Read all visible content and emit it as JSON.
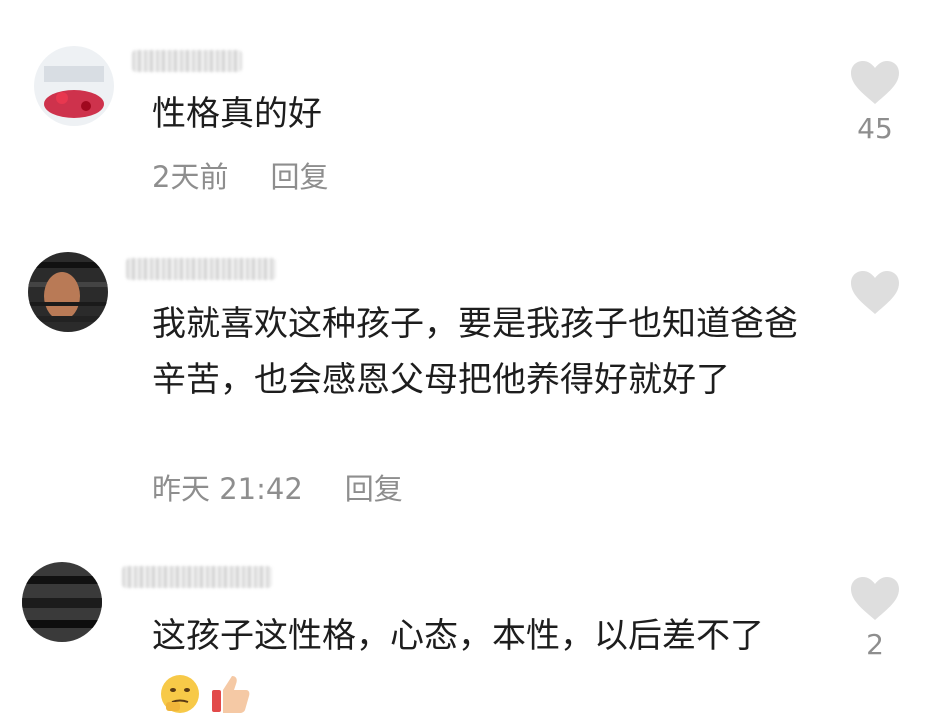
{
  "comments": [
    {
      "text": "性格真的好",
      "time": "2天前",
      "reply_label": "回复",
      "likes": "45"
    },
    {
      "text": "我就喜欢这种孩子，要是我孩子也知道爸爸辛苦，也会感恩父母把他养得好就好了",
      "time": "昨天 21:42",
      "reply_label": "回复",
      "likes": ""
    },
    {
      "text": "这孩子这性格，心态，本性，以后差不了",
      "time": "",
      "reply_label": "",
      "likes": "2",
      "emojis": [
        "thinking-face-icon",
        "thumbs-up-icon"
      ]
    }
  ],
  "colors": {
    "text": "#1d1d1d",
    "meta": "#8e8e8e",
    "heart": "#dedede"
  }
}
